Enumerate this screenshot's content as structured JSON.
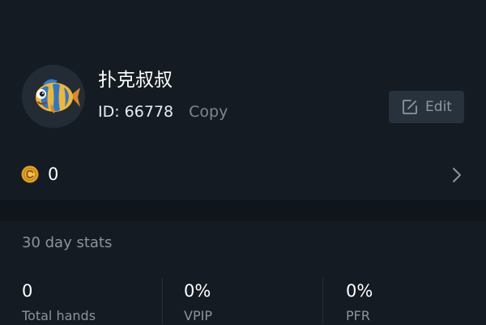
{
  "profile": {
    "nickname": "扑克叔叔",
    "id_text": "ID: 66778",
    "copy_label": "Copy",
    "edit_label": "Edit",
    "avatar_icon": "fish-avatar-icon"
  },
  "coins": {
    "value": "0",
    "icon": "coin-icon"
  },
  "stats": {
    "title": "30 day stats",
    "items": [
      {
        "value": "0",
        "label": "Total hands"
      },
      {
        "value": "0%",
        "label": "VPIP"
      },
      {
        "value": "0%",
        "label": "PFR"
      }
    ]
  },
  "colors": {
    "background": "#141b22",
    "divider": "#0f151b",
    "muted_text": "#8a949e",
    "button_bg": "#28323c",
    "coin_gold": "#e0a21f"
  }
}
